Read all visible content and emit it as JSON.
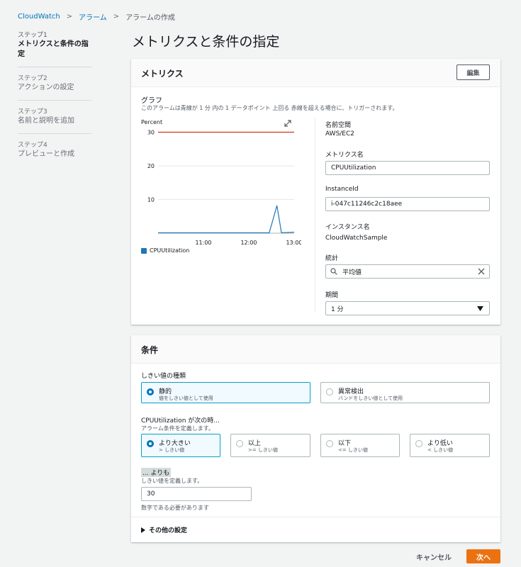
{
  "breadcrumb": {
    "items": [
      "CloudWatch",
      "アラーム",
      "アラームの作成"
    ]
  },
  "steps": [
    {
      "num": "ステップ1",
      "name": "メトリクスと条件の指定",
      "active": true
    },
    {
      "num": "ステップ2",
      "name": "アクションの設定",
      "active": false
    },
    {
      "num": "ステップ3",
      "name": "名前と説明を追加",
      "active": false
    },
    {
      "num": "ステップ4",
      "name": "プレビューと作成",
      "active": false
    }
  ],
  "page_title": "メトリクスと条件の指定",
  "metrics": {
    "title": "メトリクス",
    "edit_label": "編集",
    "graph_label": "グラフ",
    "graph_desc": "このアラームは青線が 1 分 内の 1 データポイント 上回る 赤線を超える場合に、トリガーされます。",
    "unit_label": "Percent",
    "namespace_label": "名前空間",
    "namespace_value": "AWS/EC2",
    "metric_name_label": "メトリクス名",
    "metric_name_value": "CPUUtilization",
    "instance_id_label": "InstanceId",
    "instance_id_value": "i-047c11246c2c18aee",
    "instance_name_label": "インスタンス名",
    "instance_name_value": "CloudWatchSample",
    "stat_label": "統計",
    "stat_value": "平均値",
    "period_label": "期間",
    "period_value": "1 分"
  },
  "chart_data": {
    "type": "line",
    "ylabel": "Percent",
    "ylim": [
      0,
      32
    ],
    "yticks": [
      10,
      20,
      30
    ],
    "xticks": [
      "11:00",
      "12:00",
      "13:00"
    ],
    "threshold": 30,
    "series": [
      {
        "name": "CPUUtilization",
        "color": "#1f77b4",
        "points": [
          [
            0,
            0.1
          ],
          [
            2.0,
            0.1
          ],
          [
            2.45,
            0.1
          ],
          [
            2.62,
            8.2
          ],
          [
            2.72,
            0.1
          ],
          [
            3.0,
            0.3
          ]
        ]
      }
    ],
    "threshold_color": "#d13212"
  },
  "conditions": {
    "title": "条件",
    "threshold_type_label": "しきい値の種類",
    "threshold_types": [
      {
        "title": "静的",
        "desc": "値をしきい値として使用",
        "selected": true
      },
      {
        "title": "異常検出",
        "desc": "バンドをしきい値として使用",
        "selected": false
      }
    ],
    "when_label": "CPUUtilization が次の時...",
    "when_desc": "アラーム条件を定義します。",
    "operators": [
      {
        "title": "より大きい",
        "desc": "> しきい値",
        "selected": true
      },
      {
        "title": "以上",
        "desc": ">= しきい値",
        "selected": false
      },
      {
        "title": "以下",
        "desc": "<= しきい値",
        "selected": false
      },
      {
        "title": "より低い",
        "desc": "< しきい値",
        "selected": false
      }
    ],
    "than_label": "... よりも",
    "than_desc": "しきい値を定義します。",
    "threshold_value": "30",
    "threshold_hint": "数字である必要があります",
    "other_settings": "その他の設定"
  },
  "footer": {
    "cancel": "キャンセル",
    "next": "次へ"
  },
  "colors": {
    "accent": "#0073bb",
    "primary_button": "#ec7211",
    "threshold_line": "#d13212",
    "series_line": "#1f77b4"
  }
}
